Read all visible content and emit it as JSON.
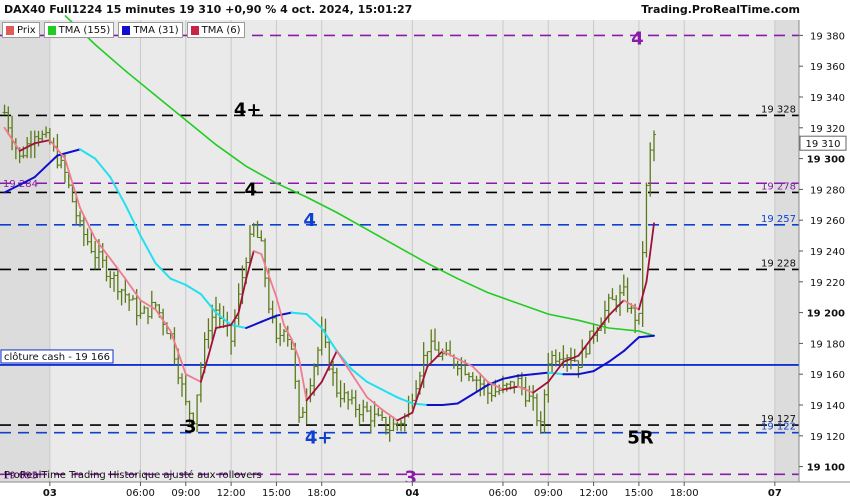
{
  "header": {
    "title": "DAX40 Full1224 15 minutes 19 310 +0,90 % 4 oct. 2024, 15:01:27",
    "site": "Trading.ProRealTime.com"
  },
  "legend": [
    {
      "label": "Prix",
      "color": "#e05a5a"
    },
    {
      "label": "TMA (155)",
      "color": "#22cc22"
    },
    {
      "label": "TMA (31)",
      "color": "#1010cc"
    },
    {
      "label": "TMA (6)",
      "color": "#cc2244"
    }
  ],
  "footer": "ProRealTime Trading  Historique ajusté aux rollovers",
  "chart_data": {
    "type": "line",
    "title": "DAX40 Full1224 15 minutes",
    "yticks": [
      "19 380",
      "19 360",
      "19 340",
      "19 320",
      "19 300",
      "19 280",
      "19 260",
      "19 240",
      "19 220",
      "19 200",
      "19 180",
      "19 160",
      "19 140",
      "19 120",
      "19 100"
    ],
    "yrange": [
      19090,
      19390
    ],
    "xticks": [
      "03",
      "06:00",
      "09:00",
      "12:00",
      "15:00",
      "18:00",
      "04",
      "06:00",
      "09:00",
      "12:00",
      "15:00",
      "18:00",
      "07"
    ],
    "xtick_hours": [
      0,
      6,
      9,
      12,
      15,
      18,
      24,
      30,
      33,
      36,
      39,
      42,
      48
    ],
    "xrange": [
      -3.3,
      49.6
    ],
    "sessions": [
      [
        0,
        24
      ],
      [
        24,
        48
      ]
    ],
    "current_price": {
      "label": "19 310",
      "value": 19310
    },
    "price_labels": [
      {
        "text": "19 328",
        "value": 19328
      },
      {
        "text": "19 278",
        "value": 19278,
        "color": "#8020a0"
      },
      {
        "text": "19 257",
        "value": 19257,
        "color": "#1040d0"
      },
      {
        "text": "19 228",
        "value": 19228
      },
      {
        "text": "19 127",
        "value": 19127
      },
      {
        "text": "19 122",
        "value": 19122,
        "color": "#1040d0"
      }
    ],
    "levels": [
      {
        "value": 19380,
        "color": "#8a1aa8"
      },
      {
        "value": 19328,
        "color": "#000000"
      },
      {
        "value": 19284,
        "color": "#8a1aa8"
      },
      {
        "value": 19278,
        "color": "#000000"
      },
      {
        "value": 19257,
        "color": "#1040d0"
      },
      {
        "value": 19228,
        "color": "#000000"
      },
      {
        "value": 19127,
        "color": "#000000"
      },
      {
        "value": 19122,
        "color": "#1040d0"
      },
      {
        "value": 19095,
        "color": "#8a1aa8"
      }
    ],
    "close_line": {
      "label": "clôture cash -  19 166",
      "value": 19166,
      "color": "#1030d0"
    },
    "left_labels": [
      {
        "text": "19 284",
        "value": 19284,
        "color": "#8a1aa8"
      },
      {
        "text": "19 095",
        "value": 19095,
        "color": "#8a1aa8"
      }
    ],
    "annotations": [
      {
        "text": "4",
        "hour": 38.9,
        "value": 19378,
        "color": "#8a1aa8"
      },
      {
        "text": "4+",
        "hour": 13.1,
        "value": 19332,
        "color": "#000000"
      },
      {
        "text": "4",
        "hour": 13.3,
        "value": 19280,
        "color": "#000000"
      },
      {
        "text": "4",
        "hour": 17.2,
        "value": 19260,
        "color": "#1040d0"
      },
      {
        "text": "3",
        "hour": 9.3,
        "value": 19126,
        "color": "#000000"
      },
      {
        "text": "4+",
        "hour": 17.8,
        "value": 19119,
        "color": "#1040d0"
      },
      {
        "text": "5R",
        "hour": 39.1,
        "value": 19119,
        "color": "#000000"
      },
      {
        "text": "3",
        "hour": 23.9,
        "value": 19093,
        "color": "#8a1aa8"
      }
    ],
    "series": [
      {
        "name": "Prix",
        "color": "#5a7a1a",
        "x": [
          -3.0,
          -2.0,
          -1.0,
          0.0,
          1.0,
          2.0,
          3.0,
          4.0,
          5.0,
          6.0,
          7.0,
          8.0,
          9.0,
          9.5,
          10.0,
          10.5,
          11.0,
          12.0,
          13.0,
          13.5,
          14.0,
          14.5,
          15.0,
          15.5,
          16.0,
          16.5,
          17.0,
          18.0,
          19.0,
          20.0,
          21.0,
          22.0,
          22.5,
          23.0,
          23.5,
          24.0,
          25.0,
          26.0,
          27.0,
          28.0,
          29.0,
          30.0,
          31.0,
          32.0,
          32.5,
          33.0,
          34.0,
          35.0,
          36.0,
          37.0,
          38.0,
          38.5,
          39.0,
          39.3,
          39.6,
          39.9,
          40.1
        ],
        "y": [
          19330,
          19300,
          19318,
          19310,
          19290,
          19255,
          19238,
          19225,
          19212,
          19198,
          19205,
          19185,
          19140,
          19132,
          19165,
          19192,
          19202,
          19182,
          19237,
          19255,
          19242,
          19205,
          19180,
          19192,
          19178,
          19128,
          19148,
          19185,
          19150,
          19140,
          19135,
          19128,
          19125,
          19128,
          19132,
          19148,
          19178,
          19172,
          19168,
          19160,
          19148,
          19150,
          19155,
          19140,
          19125,
          19170,
          19175,
          19168,
          19188,
          19205,
          19212,
          19200,
          19195,
          19250,
          19295,
          19312,
          19318
        ]
      },
      {
        "name": "TMA (6)",
        "color": "#e03a5a",
        "x": [
          -3.0,
          -2.0,
          -1.0,
          0.0,
          1.0,
          2.0,
          3.0,
          4.0,
          5.0,
          6.0,
          7.0,
          8.0,
          9.0,
          10.0,
          10.5,
          11.0,
          12.0,
          12.5,
          13.0,
          13.5,
          14.0,
          15.0,
          15.5,
          16.0,
          16.5,
          17.0,
          18.0,
          19.0,
          20.0,
          21.0,
          22.0,
          23.0,
          24.0,
          25.0,
          26.0,
          27.0,
          28.0,
          29.0,
          30.0,
          31.0,
          32.0,
          33.0,
          34.0,
          35.0,
          36.0,
          37.0,
          38.0,
          39.0,
          39.5,
          40.0
        ],
        "y": [
          19320,
          19305,
          19310,
          19312,
          19300,
          19268,
          19248,
          19235,
          19222,
          19208,
          19202,
          19188,
          19160,
          19155,
          19172,
          19190,
          19192,
          19200,
          19222,
          19240,
          19238,
          19210,
          19192,
          19183,
          19170,
          19143,
          19155,
          19175,
          19160,
          19145,
          19137,
          19130,
          19135,
          19165,
          19175,
          19170,
          19165,
          19155,
          19150,
          19152,
          19148,
          19155,
          19168,
          19172,
          19185,
          19198,
          19208,
          19202,
          19220,
          19258
        ]
      },
      {
        "name": "TMA (31)",
        "color": "#1010cc",
        "cyan": "#22e0f0",
        "x": [
          -3.0,
          -1.0,
          0.5,
          2.0,
          3.0,
          4.0,
          5.0,
          6.0,
          7.0,
          8.0,
          9.0,
          10.0,
          11.0,
          12.0,
          13.0,
          14.0,
          15.0,
          16.0,
          17.0,
          18.0,
          19.0,
          20.0,
          21.0,
          22.0,
          23.0,
          24.0,
          25.0,
          26.0,
          27.0,
          28.0,
          29.0,
          30.0,
          31.0,
          32.0,
          33.0,
          34.0,
          35.0,
          36.0,
          37.0,
          38.0,
          39.0,
          40.0
        ],
        "y": [
          19278,
          19288,
          19302,
          19306,
          19300,
          19288,
          19270,
          19250,
          19232,
          19222,
          19218,
          19212,
          19200,
          19192,
          19190,
          19194,
          19198,
          19200,
          19199,
          19190,
          19175,
          19163,
          19155,
          19150,
          19145,
          19141,
          19140,
          19140,
          19141,
          19147,
          19153,
          19157,
          19159,
          19160,
          19161,
          19160,
          19160,
          19162,
          19168,
          19175,
          19184,
          19185
        ]
      },
      {
        "name": "TMA (155)",
        "color": "#22cc22",
        "x": [
          1.0,
          3.0,
          5.0,
          7.0,
          9.0,
          11.0,
          13.0,
          15.0,
          17.0,
          19.0,
          21.0,
          23.0,
          25.0,
          27.0,
          29.0,
          31.0,
          33.0,
          35.0,
          37.0,
          39.0,
          40.0
        ],
        "y": [
          19393,
          19374,
          19357,
          19341,
          19325,
          19309,
          19295,
          19284,
          19275,
          19265,
          19254,
          19243,
          19232,
          19222,
          19213,
          19206,
          19199,
          19195,
          19190,
          19188,
          19185
        ]
      }
    ]
  }
}
